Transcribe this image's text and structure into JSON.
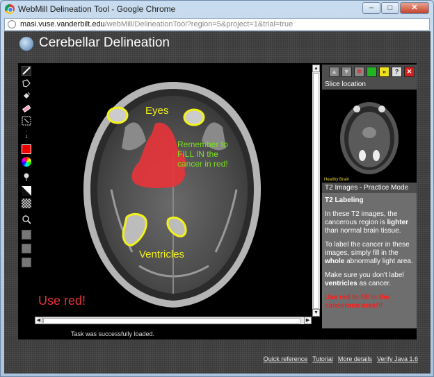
{
  "window": {
    "title": "WebMill Delineation Tool - Google Chrome",
    "url_host": "masi.vuse.vanderbilt.edu",
    "url_path": "/webMill/DelineationTool?region=5&project=1&trial=true"
  },
  "app": {
    "title": "Cerebellar Delineation"
  },
  "toolbar": {
    "brush_size": "1"
  },
  "canvas": {
    "annotation_eyes": "Eyes",
    "annotation_remember_1": "Remember to",
    "annotation_remember_2": "FILL IN the",
    "annotation_remember_3": "cancer in red!",
    "annotation_ventricles": "Ventricles",
    "annotation_use_red": "Use red!"
  },
  "right_panel": {
    "slice_location_label": "Slice location",
    "thumbnail_caption": "Healthy Brain",
    "mode_label": "T2 Images - Practice Mode",
    "heading": "T2 Labeling",
    "p1_a": "In these T2 images, the cancerous region is ",
    "p1_bold": "lighter",
    "p1_b": " than normal brain tissue.",
    "p2_a": "To label the cancer in these images, simply fill in the ",
    "p2_bold": "whole",
    "p2_b": " abnormally light area.",
    "p3_a": "Make sure you don't label ",
    "p3_bold": "ventricles",
    "p3_b": " as cancer.",
    "warning": "Use red to fill in the cancerous area!!!"
  },
  "status": {
    "message": "Task was successfully loaded."
  },
  "footer": {
    "links": [
      "Quick reference",
      "Tutorial",
      "More details",
      "Verify Java 1.6"
    ]
  },
  "colors": {
    "annotation_yellow": "#f2f21a",
    "annotation_green": "#7be01f",
    "fill_red": "#e8343a",
    "warning_red": "#ff1a1a"
  }
}
